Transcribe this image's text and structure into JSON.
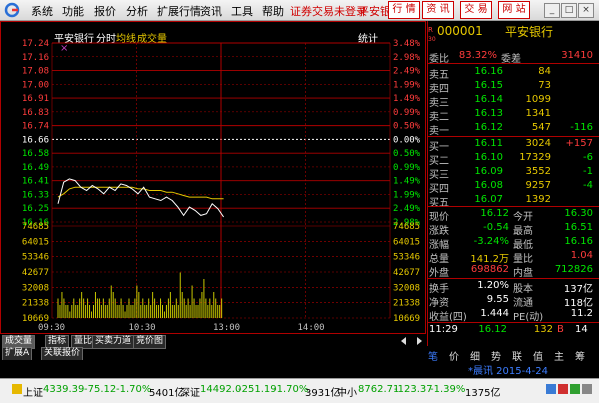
{
  "menu": [
    "系统",
    "功能",
    "报价",
    "分析",
    "扩展行情",
    "资讯",
    "工具",
    "帮助"
  ],
  "trade_not_logged": "证券交易未登录",
  "trade_short": "平安银",
  "quick_buttons": [
    "行 情",
    "资 讯",
    "交 易",
    "网 站"
  ],
  "window_buttons": [
    "_",
    "□",
    "×"
  ],
  "chart": {
    "stock_name": "平安银行",
    "mode": "分时",
    "avg_label": "均线",
    "volume_label": "成交量",
    "stats_label": "统计",
    "price_labels": [
      "17.24",
      "17.16",
      "17.08",
      "17.00",
      "16.91",
      "16.83",
      "16.74",
      "16.66",
      "16.58",
      "16.49",
      "16.41",
      "16.33",
      "16.25",
      "16.16"
    ],
    "pct_labels": [
      "3.48%",
      "2.98%",
      "2.49%",
      "1.99%",
      "1.49%",
      "0.99%",
      "0.50%",
      "0.00%",
      "0.50%",
      "0.99%",
      "1.49%",
      "1.99%",
      "2.49%",
      "2.98%"
    ],
    "vol_labels_left": [
      "74685",
      "64015",
      "53346",
      "42677",
      "32008",
      "21338",
      "10669"
    ],
    "vol_labels_right": [
      "74685",
      "64015",
      "53346",
      "42677",
      "32008",
      "21338",
      "10669"
    ],
    "time_labels": [
      "09:30",
      "10:30",
      "13:00",
      "14:00"
    ],
    "chart_data": {
      "type": "line",
      "series": [
        {
          "values": [
            16.27,
            16.4,
            16.42,
            16.41,
            16.37,
            16.35,
            16.38,
            16.36,
            16.33,
            16.37,
            16.35,
            16.39,
            16.38,
            16.36,
            16.33,
            16.37,
            16.31,
            16.3,
            16.29,
            16.31,
            16.29,
            16.25,
            16.2,
            16.25,
            16.23,
            16.2,
            16.21,
            16.27,
            16.24,
            16.19
          ]
        },
        {
          "values": [
            16.31,
            16.33,
            16.36,
            16.37,
            16.37,
            16.37,
            16.37,
            16.37,
            16.37,
            16.37,
            16.37,
            16.37,
            16.37,
            16.37,
            16.36,
            16.36,
            16.35,
            16.35,
            16.35,
            16.34,
            16.34,
            16.33,
            16.32,
            16.31,
            16.31,
            16.31,
            16.31,
            16.3,
            16.3,
            16.3
          ]
        }
      ],
      "ylim": [
        16.16,
        17.24
      ]
    }
  },
  "quote": {
    "code": "000001",
    "name": "平安银行",
    "weibi_label": "委比",
    "weibi_value": "83.32%",
    "weicha_label": "委差",
    "weicha_value": "31410",
    "sells": [
      {
        "label": "卖五",
        "price": "16.16",
        "vol": "84",
        "chg": ""
      },
      {
        "label": "卖四",
        "price": "16.15",
        "vol": "73",
        "chg": ""
      },
      {
        "label": "卖三",
        "price": "16.14",
        "vol": "1099",
        "chg": ""
      },
      {
        "label": "卖二",
        "price": "16.13",
        "vol": "1341",
        "chg": ""
      },
      {
        "label": "卖一",
        "price": "16.12",
        "vol": "547",
        "chg": "-116"
      }
    ],
    "buys": [
      {
        "label": "买一",
        "price": "16.11",
        "vol": "3024",
        "chg": "+157"
      },
      {
        "label": "买二",
        "price": "16.10",
        "vol": "17329",
        "chg": "-6"
      },
      {
        "label": "买三",
        "price": "16.09",
        "vol": "3552",
        "chg": "-1"
      },
      {
        "label": "买四",
        "price": "16.08",
        "vol": "9257",
        "chg": "-4"
      },
      {
        "label": "买五",
        "price": "16.07",
        "vol": "1392",
        "chg": ""
      }
    ],
    "stats": [
      {
        "l1": "现价",
        "v1": "16.12",
        "l2": "今开",
        "v2": "16.30"
      },
      {
        "l1": "涨跌",
        "v1": "-0.54",
        "l2": "最高",
        "v2": "16.51"
      },
      {
        "l1": "涨幅",
        "v1": "-3.24%",
        "l2": "最低",
        "v2": "16.16"
      },
      {
        "l1": "总量",
        "v1": "141.2万",
        "l2": "量比",
        "v2": "1.04"
      },
      {
        "l1": "外盘",
        "v1": "698862",
        "l2": "内盘",
        "v2": "712826"
      }
    ],
    "stats2": [
      {
        "l1": "换手",
        "v1": "1.20%",
        "l2": "股本",
        "v2": "137亿"
      },
      {
        "l1": "净资",
        "v1": "9.55",
        "l2": "流通",
        "v2": "118亿"
      },
      {
        "l1": "收益(四)",
        "v1": "1.444",
        "l2": "PE(动)",
        "v2": "11.2"
      }
    ],
    "tick": {
      "time": "11:29",
      "price": "16.12",
      "vol": "132",
      "flag": "B",
      "n": "14"
    }
  },
  "bottom_tabs": [
    "成交量",
    "指标",
    "量比",
    "买卖力道",
    "竞价图"
  ],
  "bottom_tabs2": [
    "扩展A",
    "关联报价"
  ],
  "right_tabs": [
    "笔",
    "价",
    "细",
    "势",
    "联",
    "值",
    "主",
    "筹"
  ],
  "news": "*晨讯 2015-4-24",
  "status": {
    "sh_label": "上证",
    "sh_index": "4339.39",
    "sh_chg": "-75.12",
    "sh_pct": "-1.70%",
    "sh_amt": "5401亿",
    "sz_label": "深证",
    "sz_index": "14492.0",
    "sz_chg": "-251.19",
    "sz_pct": "-1.70%",
    "sz_amt": "3931亿",
    "zx_label": "中小",
    "zx_index": "8762.71",
    "zx_chg": "-123.37",
    "zx_pct": "-1.39%",
    "zx_amt": "1375亿"
  },
  "colors": {
    "up": "#ff3c3c",
    "down": "#00e600",
    "flat": "#ffffff",
    "line": "#ffffff",
    "avg": "#e6c800",
    "vol": "#c8c800",
    "grid": "#b00000"
  }
}
